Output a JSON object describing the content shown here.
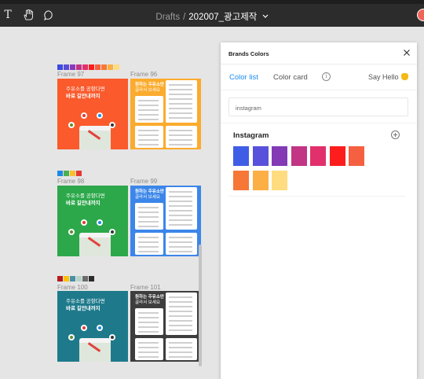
{
  "toolbar": {
    "breadcrumb_root": "Drafts",
    "breadcrumb_sep": "/",
    "file_name": "202007_광고제작",
    "text_tool": "T"
  },
  "frames": [
    {
      "label": "Frame 97",
      "swatches": [
        "#3b4be0",
        "#5a4ed8",
        "#8a3ab9",
        "#c13584",
        "#e1306c",
        "#fd1d1d",
        "#f56040",
        "#f77737",
        "#fcaf45",
        "#ffdc80"
      ],
      "bg": "#fa5a2c",
      "headline": "주유소를 공항다면",
      "subhead": "바로 길안내까지"
    },
    {
      "label": "Frame 96",
      "bg": "#fbab2d",
      "headline": "원하는 주유소만",
      "subhead": "골라서 보세요"
    },
    {
      "label": "Frame 98",
      "swatches": [
        "#1e88e5",
        "#4caf50",
        "#fbc02d",
        "#e53935"
      ],
      "bg": "#2ca84a",
      "headline": "주유소를 공항다면",
      "subhead": "바로 길안내까지"
    },
    {
      "label": "Frame 99",
      "bg": "#3c86e9",
      "headline": "원하는 주유소만",
      "subhead": "골라서 보세요"
    },
    {
      "label": "Frame 100",
      "swatches": [
        "#b71c1c",
        "#ffc107",
        "#4a90a4",
        "#b7d3c9",
        "#6b6b6b",
        "#2b2b2b"
      ],
      "bg": "#1e7a8b",
      "headline": "주유소를 공항다면",
      "subhead": "바로 길안내까지"
    },
    {
      "label": "Frame 101",
      "bg": "#3d3d3d",
      "headline": "원하는 주유소만",
      "subhead": "골라서 보세요"
    }
  ],
  "panel": {
    "title": "Brands Colors",
    "tabs": [
      "Color list",
      "Color card"
    ],
    "active_tab": "Color list",
    "info_glyph": "i",
    "say_hello": "Say Hello",
    "search_value": "instagram",
    "brand": {
      "name": "Instagram",
      "colors": [
        "#405de6",
        "#5851db",
        "#833ab4",
        "#c13584",
        "#e1306c",
        "#fd1d1d",
        "#f56040",
        "#f77737",
        "#fcaf45",
        "#ffdc80"
      ]
    }
  },
  "icons": [
    "text-tool-icon",
    "hand-tool-icon",
    "comment-tool-icon",
    "chevron-down-icon",
    "avatar",
    "close-icon",
    "info-icon",
    "wave-hand-icon",
    "add-circle-icon"
  ],
  "colors": {
    "accent": "#1a8cf0",
    "toolbar": "#2c2c2c",
    "canvas": "#e5e5e5"
  }
}
